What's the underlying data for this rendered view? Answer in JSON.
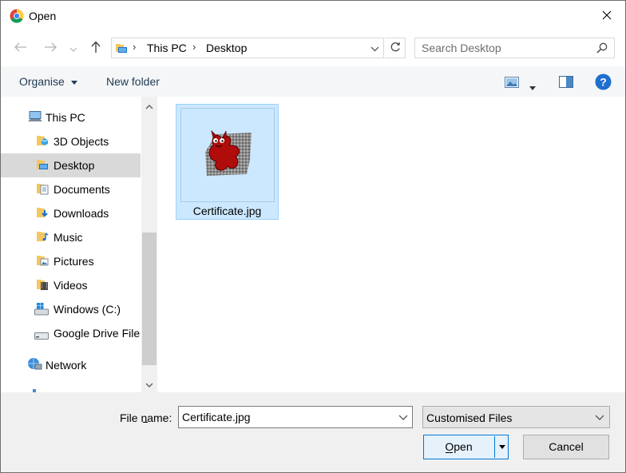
{
  "window": {
    "title": "Open",
    "app_icon": "chrome-icon",
    "close_icon": "close-icon"
  },
  "navigation": {
    "back_icon": "back-arrow-icon",
    "forward_icon": "forward-arrow-icon",
    "recent_icon": "chevron-down-icon",
    "up_icon": "up-arrow-icon",
    "breadcrumb": [
      "This PC",
      "Desktop"
    ],
    "refresh_icon": "refresh-icon"
  },
  "search": {
    "placeholder": "Search Desktop",
    "icon": "search-icon"
  },
  "toolbar": {
    "organise_label": "Organise",
    "new_folder_label": "New folder",
    "view_icon": "view-options-icon",
    "preview_icon": "preview-pane-icon",
    "help_icon": "help-icon"
  },
  "sidebar": {
    "items": [
      {
        "label": "This PC",
        "icon": "computer-icon",
        "indent": 0
      },
      {
        "label": "3D Objects",
        "icon": "folder-3d-icon",
        "indent": 1
      },
      {
        "label": "Desktop",
        "icon": "folder-desktop-icon",
        "indent": 1,
        "selected": true
      },
      {
        "label": "Documents",
        "icon": "folder-documents-icon",
        "indent": 1
      },
      {
        "label": "Downloads",
        "icon": "folder-downloads-icon",
        "indent": 1
      },
      {
        "label": "Music",
        "icon": "folder-music-icon",
        "indent": 1
      },
      {
        "label": "Pictures",
        "icon": "folder-pictures-icon",
        "indent": 1
      },
      {
        "label": "Videos",
        "icon": "folder-videos-icon",
        "indent": 1
      },
      {
        "label": "Windows (C:)",
        "icon": "drive-windows-icon",
        "indent": 1
      },
      {
        "label": "Google Drive File",
        "icon": "drive-icon",
        "indent": 1
      },
      {
        "label": "Network",
        "icon": "network-icon",
        "indent": 0
      }
    ]
  },
  "files": [
    {
      "name": "Certificate.jpg",
      "icon": "image-thumbnail-icon",
      "selected": true
    }
  ],
  "footer": {
    "file_name_label": "File name:",
    "file_name_value": "Certificate.jpg",
    "file_type_value": "Customised Files",
    "open_label": "Open",
    "cancel_label": "Cancel"
  },
  "colors": {
    "selection": "#cce8ff",
    "selection_border": "#99d1ff",
    "accent": "#0078d7",
    "toolbar_bg": "#f5f6f7",
    "footer_bg": "#f0f0f0"
  }
}
